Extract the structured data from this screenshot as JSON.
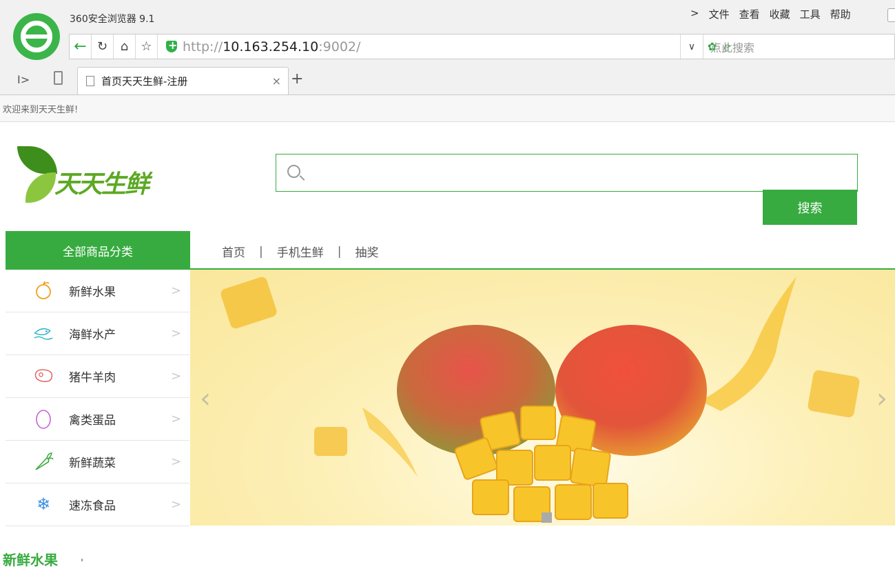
{
  "browser": {
    "title": "360安全浏览器 9.1",
    "menu": [
      "文件",
      "查看",
      "收藏",
      "工具",
      "帮助"
    ],
    "menu_chevron": ">",
    "url_scheme": "http://",
    "url_host": "10.163.254.10",
    "url_rest": ":9002/",
    "search_placeholder": "点此搜索",
    "tab_title": "首页天天生鲜-注册",
    "new_tab": "+",
    "close_tab": "×"
  },
  "page": {
    "welcome": "欢迎来到天天生鲜!",
    "logo_text": "天天生鲜",
    "search_button": "搜索",
    "category_header": "全部商品分类",
    "nav": [
      "首页",
      "手机生鲜",
      "抽奖"
    ],
    "nav_separator": "|",
    "categories": [
      {
        "label": "新鲜水果",
        "icon": "fruit-icon"
      },
      {
        "label": "海鲜水产",
        "icon": "fish-icon"
      },
      {
        "label": "猪牛羊肉",
        "icon": "meat-icon"
      },
      {
        "label": "禽类蛋品",
        "icon": "egg-icon"
      },
      {
        "label": "新鲜蔬菜",
        "icon": "carrot-icon"
      },
      {
        "label": "速冻食品",
        "icon": "snowflake-icon"
      }
    ],
    "section_title": "新鲜水果",
    "colors": {
      "brand_green": "#37ab40",
      "banner_bg": "#fdf0b8"
    }
  }
}
